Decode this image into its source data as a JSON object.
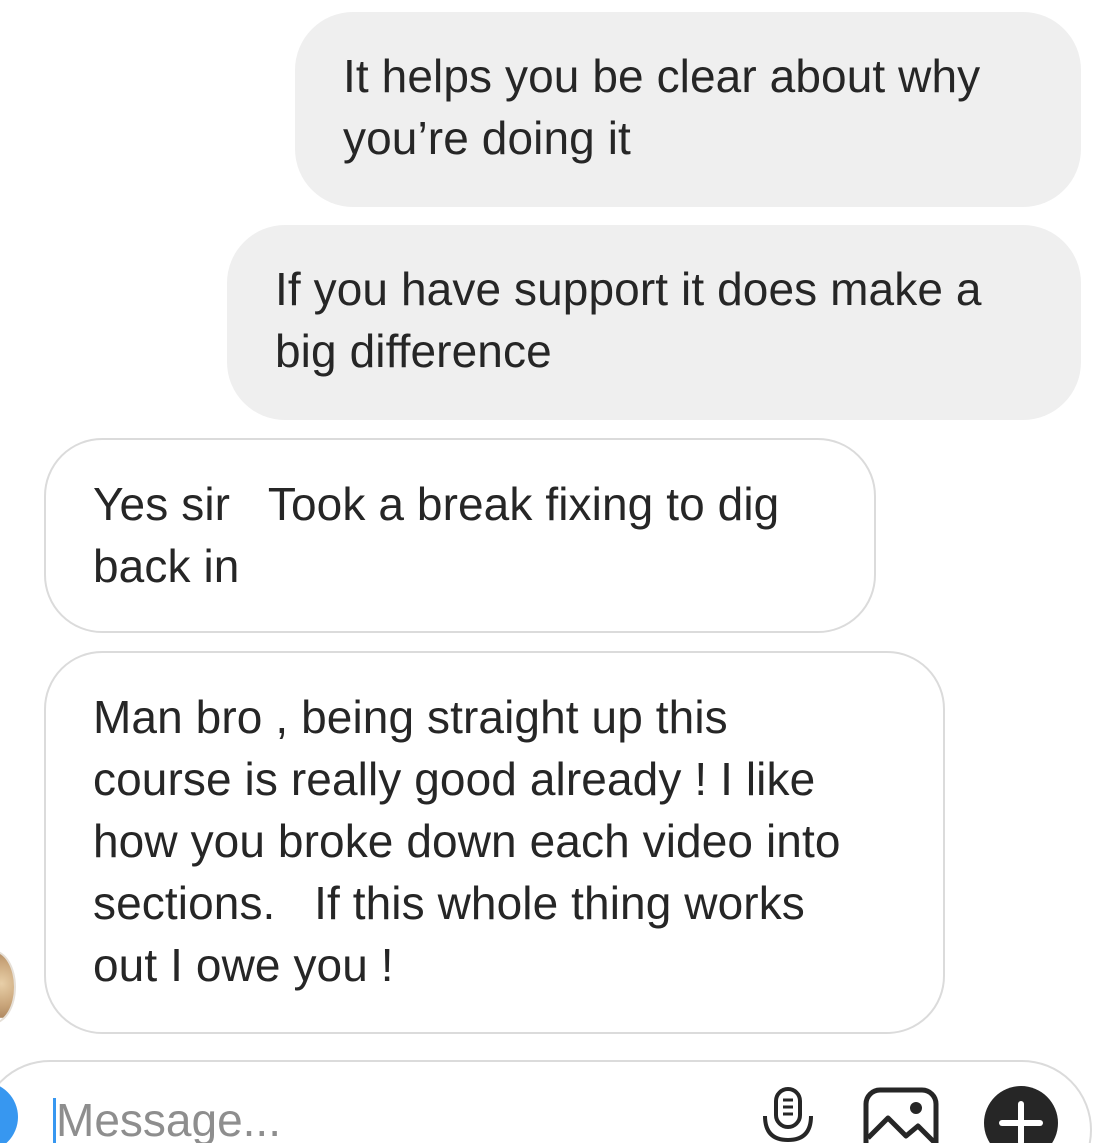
{
  "messages": [
    {
      "direction": "sent",
      "text": "It helps you be clear about why\nyou’re doing it"
    },
    {
      "direction": "sent",
      "text": "If you have support it does make a\nbig difference"
    },
    {
      "direction": "received",
      "text": "Yes sir   Took a break fixing to dig\nback in"
    },
    {
      "direction": "received",
      "text": "Man bro , being straight up this\ncourse is really good already ! I like\nhow you broke down each video into\nsections.   If this whole thing works\nout I owe you !"
    }
  ],
  "composer": {
    "placeholder": "Message...",
    "value": ""
  },
  "icons": {
    "camera": "camera-icon",
    "mic": "microphone-icon",
    "gallery": "image-gallery-icon",
    "plus": "plus-icon"
  },
  "colors": {
    "sent_bubble": "#efefef",
    "received_border": "#dbdbdb",
    "accent": "#3797f0",
    "text": "#262626",
    "placeholder": "#8e8e8e"
  }
}
